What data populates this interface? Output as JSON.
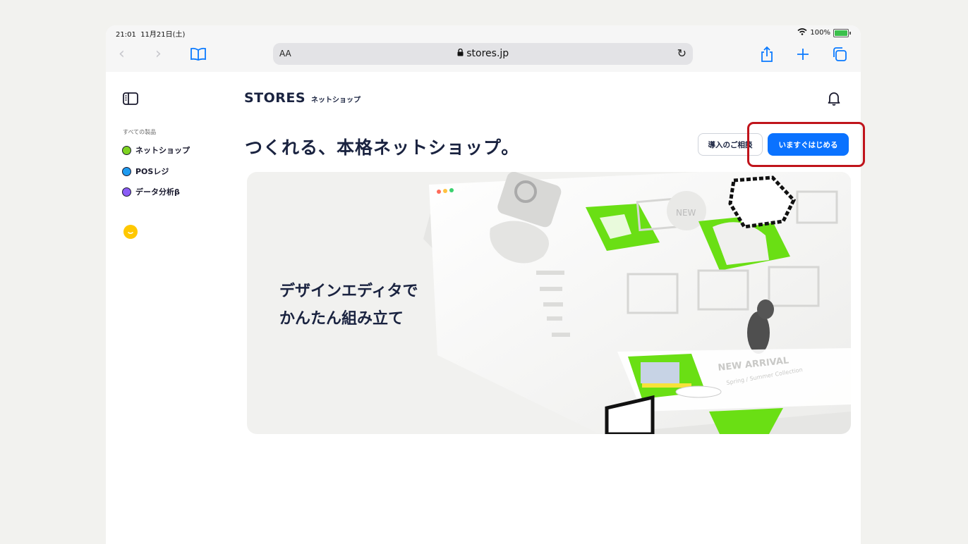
{
  "status_bar": {
    "time": "21:01",
    "date": "11月21日(土)",
    "battery": "100%"
  },
  "browser": {
    "text_size_label": "AA",
    "url": "stores.jp",
    "lock_glyph": "🔒"
  },
  "sidebar": {
    "heading": "すべての製品",
    "items": [
      {
        "label": "ネットショップ",
        "color": "#7ed321"
      },
      {
        "label": "POSレジ",
        "color": "#1e9bf0"
      },
      {
        "label": "データ分析β",
        "color": "#8b5cf6"
      }
    ]
  },
  "header": {
    "logo": "STORES",
    "logo_sub": "ネットショップ"
  },
  "hero": {
    "headline": "つくれる、本格ネットショップ。",
    "consult_label": "導入のご相談",
    "start_label": "いますぐはじめる",
    "image_text_line1": "デザインエディタで",
    "image_text_line2": "かんたん組み立て",
    "illustration_badge": "NEW",
    "illustration_title": "NEW ARRIVAL",
    "illustration_subtitle": "Spring / Summer Collection"
  },
  "colors": {
    "accent": "#0a72ff",
    "highlight": "#c0141b",
    "green": "#6adf14"
  }
}
